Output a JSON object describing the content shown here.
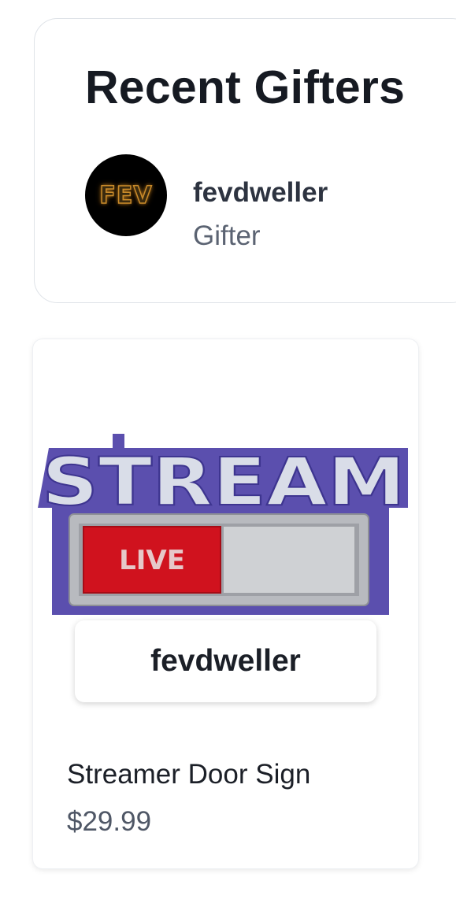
{
  "recent_gifters": {
    "title": "Recent Gifters",
    "gifters": [
      {
        "name": "fevdweller",
        "role": "Gifter",
        "avatar_text": "FEV"
      }
    ]
  },
  "product": {
    "image": {
      "headline": "STREAM",
      "status_text": "LIVE"
    },
    "gifter_label": "fevdweller",
    "name": "Streamer Door Sign",
    "price": "$29.99"
  },
  "colors": {
    "sign_purple": "#5b4fae",
    "sign_letters": "#d9dde8",
    "live_red": "#d0121e",
    "slider_silver": "#c3c5c9"
  }
}
